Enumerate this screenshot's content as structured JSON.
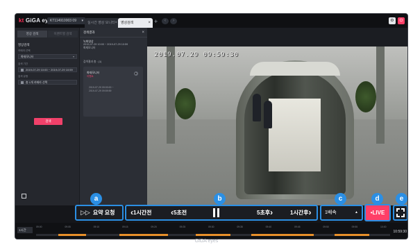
{
  "app": {
    "logo_prefix": "kt",
    "logo_name": "GiGA eyes",
    "device_label": "KT114910003 09",
    "footer_brand": "GiGA eyes"
  },
  "tabs": [
    {
      "label": "실시간 영상 모니터"
    },
    {
      "label": "영상검색"
    }
  ],
  "left_panel": {
    "tab_search": "영상 검색",
    "tab_summary": "이벤트별 검색",
    "heading": "영상검색",
    "camera_label": "카메라 선택",
    "camera_value": "화재모니터",
    "period_label": "검색 기간",
    "period_value": "2019-07-29 10:00 ~ 2019-07-29 10:59",
    "type_label": "검색 유형",
    "type_value": "총 1개 카메라 선택",
    "search_button": "검색"
  },
  "result_panel": {
    "title": "검색결과",
    "block_heading": "녹화영상",
    "block_line1": "2019-07-29 10:00 ~ 2019-07-29 10:59",
    "block_line2": "화재모니터",
    "sub_heading": "검색결과 총 : (1)",
    "card_camera": "화재모니터",
    "card_tag": "이벤트",
    "card_start": "2019-07-29 09:00:00 ~",
    "card_end": "2019-07-29 09:59:59"
  },
  "video": {
    "timestamp": "2019.07.29 09:59:30"
  },
  "controls": {
    "summary_label": "요약 요청",
    "back_1h": "1시간전",
    "back_5s": "5초전",
    "fwd_5s": "5초후",
    "fwd_1h": "1시간후",
    "speed": "1배속",
    "live": "LIVE",
    "live_prefix": "•"
  },
  "timeline": {
    "zoom": "1시간",
    "ticks": [
      "09:00",
      "09:05",
      "09:10",
      "09:15",
      "09:20",
      "09:25",
      "09:30",
      "09:35",
      "09:40",
      "09:45",
      "09:50",
      "09:55",
      "10:00"
    ],
    "current_time": "10:59:30"
  },
  "badges": [
    "a",
    "b",
    "c",
    "d",
    "e"
  ],
  "colors": {
    "accent_blue": "#2b8fe4",
    "live_pink": "#ff3f67",
    "recording_orange": "#e8902a"
  }
}
